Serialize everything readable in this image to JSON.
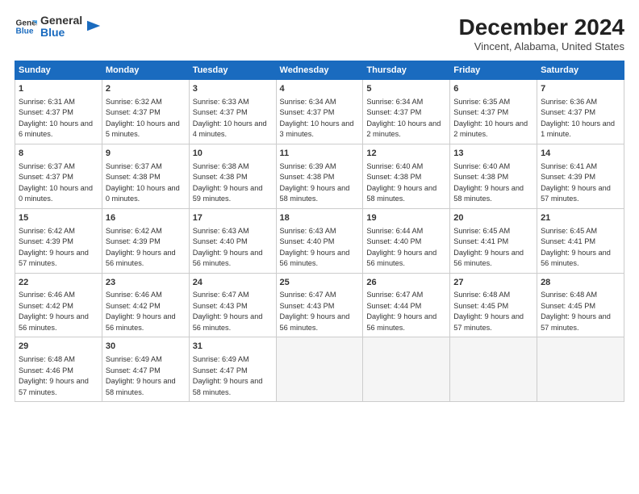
{
  "logo": {
    "line1": "General",
    "line2": "Blue"
  },
  "title": "December 2024",
  "subtitle": "Vincent, Alabama, United States",
  "days_of_week": [
    "Sunday",
    "Monday",
    "Tuesday",
    "Wednesday",
    "Thursday",
    "Friday",
    "Saturday"
  ],
  "weeks": [
    [
      {
        "day": "1",
        "sunrise": "6:31 AM",
        "sunset": "4:37 PM",
        "daylight": "10 hours and 6 minutes."
      },
      {
        "day": "2",
        "sunrise": "6:32 AM",
        "sunset": "4:37 PM",
        "daylight": "10 hours and 5 minutes."
      },
      {
        "day": "3",
        "sunrise": "6:33 AM",
        "sunset": "4:37 PM",
        "daylight": "10 hours and 4 minutes."
      },
      {
        "day": "4",
        "sunrise": "6:34 AM",
        "sunset": "4:37 PM",
        "daylight": "10 hours and 3 minutes."
      },
      {
        "day": "5",
        "sunrise": "6:34 AM",
        "sunset": "4:37 PM",
        "daylight": "10 hours and 2 minutes."
      },
      {
        "day": "6",
        "sunrise": "6:35 AM",
        "sunset": "4:37 PM",
        "daylight": "10 hours and 2 minutes."
      },
      {
        "day": "7",
        "sunrise": "6:36 AM",
        "sunset": "4:37 PM",
        "daylight": "10 hours and 1 minute."
      }
    ],
    [
      {
        "day": "8",
        "sunrise": "6:37 AM",
        "sunset": "4:37 PM",
        "daylight": "10 hours and 0 minutes."
      },
      {
        "day": "9",
        "sunrise": "6:37 AM",
        "sunset": "4:38 PM",
        "daylight": "10 hours and 0 minutes."
      },
      {
        "day": "10",
        "sunrise": "6:38 AM",
        "sunset": "4:38 PM",
        "daylight": "9 hours and 59 minutes."
      },
      {
        "day": "11",
        "sunrise": "6:39 AM",
        "sunset": "4:38 PM",
        "daylight": "9 hours and 58 minutes."
      },
      {
        "day": "12",
        "sunrise": "6:40 AM",
        "sunset": "4:38 PM",
        "daylight": "9 hours and 58 minutes."
      },
      {
        "day": "13",
        "sunrise": "6:40 AM",
        "sunset": "4:38 PM",
        "daylight": "9 hours and 58 minutes."
      },
      {
        "day": "14",
        "sunrise": "6:41 AM",
        "sunset": "4:39 PM",
        "daylight": "9 hours and 57 minutes."
      }
    ],
    [
      {
        "day": "15",
        "sunrise": "6:42 AM",
        "sunset": "4:39 PM",
        "daylight": "9 hours and 57 minutes."
      },
      {
        "day": "16",
        "sunrise": "6:42 AM",
        "sunset": "4:39 PM",
        "daylight": "9 hours and 56 minutes."
      },
      {
        "day": "17",
        "sunrise": "6:43 AM",
        "sunset": "4:40 PM",
        "daylight": "9 hours and 56 minutes."
      },
      {
        "day": "18",
        "sunrise": "6:43 AM",
        "sunset": "4:40 PM",
        "daylight": "9 hours and 56 minutes."
      },
      {
        "day": "19",
        "sunrise": "6:44 AM",
        "sunset": "4:40 PM",
        "daylight": "9 hours and 56 minutes."
      },
      {
        "day": "20",
        "sunrise": "6:45 AM",
        "sunset": "4:41 PM",
        "daylight": "9 hours and 56 minutes."
      },
      {
        "day": "21",
        "sunrise": "6:45 AM",
        "sunset": "4:41 PM",
        "daylight": "9 hours and 56 minutes."
      }
    ],
    [
      {
        "day": "22",
        "sunrise": "6:46 AM",
        "sunset": "4:42 PM",
        "daylight": "9 hours and 56 minutes."
      },
      {
        "day": "23",
        "sunrise": "6:46 AM",
        "sunset": "4:42 PM",
        "daylight": "9 hours and 56 minutes."
      },
      {
        "day": "24",
        "sunrise": "6:47 AM",
        "sunset": "4:43 PM",
        "daylight": "9 hours and 56 minutes."
      },
      {
        "day": "25",
        "sunrise": "6:47 AM",
        "sunset": "4:43 PM",
        "daylight": "9 hours and 56 minutes."
      },
      {
        "day": "26",
        "sunrise": "6:47 AM",
        "sunset": "4:44 PM",
        "daylight": "9 hours and 56 minutes."
      },
      {
        "day": "27",
        "sunrise": "6:48 AM",
        "sunset": "4:45 PM",
        "daylight": "9 hours and 57 minutes."
      },
      {
        "day": "28",
        "sunrise": "6:48 AM",
        "sunset": "4:45 PM",
        "daylight": "9 hours and 57 minutes."
      }
    ],
    [
      {
        "day": "29",
        "sunrise": "6:48 AM",
        "sunset": "4:46 PM",
        "daylight": "9 hours and 57 minutes."
      },
      {
        "day": "30",
        "sunrise": "6:49 AM",
        "sunset": "4:47 PM",
        "daylight": "9 hours and 58 minutes."
      },
      {
        "day": "31",
        "sunrise": "6:49 AM",
        "sunset": "4:47 PM",
        "daylight": "9 hours and 58 minutes."
      },
      null,
      null,
      null,
      null
    ]
  ],
  "labels": {
    "sunrise": "Sunrise:",
    "sunset": "Sunset:",
    "daylight": "Daylight:"
  }
}
